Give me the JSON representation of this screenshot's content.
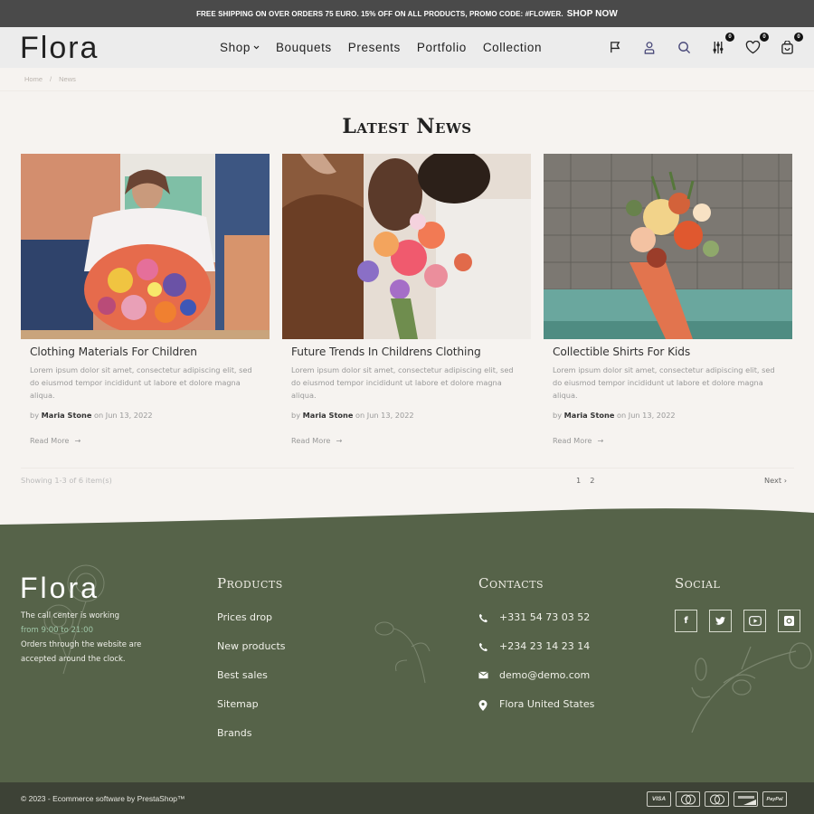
{
  "topbar": {
    "message": "FREE SHIPPING ON OVER ORDERS 75 EURO. 15% OFF ON ALL PRODUCTS, PROMO CODE: #FLOWER.",
    "cta": "SHOP NOW"
  },
  "header": {
    "logo": "Flora",
    "nav": [
      {
        "label": "Shop",
        "has_dropdown": true
      },
      {
        "label": "Bouquets"
      },
      {
        "label": "Presents"
      },
      {
        "label": "Portfolio"
      },
      {
        "label": "Collection"
      }
    ],
    "icons": [
      {
        "name": "flag-icon"
      },
      {
        "name": "user-icon"
      },
      {
        "name": "search-icon"
      },
      {
        "name": "compare-icon",
        "count": "0"
      },
      {
        "name": "heart-icon",
        "count": "0"
      },
      {
        "name": "cart-icon",
        "count": "0"
      }
    ],
    "accent_color": "#4a4a7a"
  },
  "breadcrumb": [
    {
      "label": "Home"
    },
    {
      "label": "News"
    }
  ],
  "main": {
    "title": "Latest News",
    "posts": [
      {
        "title": "Clothing Materials For Children",
        "excerpt": "Lorem ipsum dolor sit amet, consectetur adipiscing elit, sed do eiusmod tempor incididunt ut labore et dolore magna aliqua.",
        "by": "by",
        "author": "Maria Stone",
        "date": "on Jun 13, 2022",
        "read_more": "Read More"
      },
      {
        "title": "Future Trends In Childrens Clothing",
        "excerpt": "Lorem ipsum dolor sit amet, consectetur adipiscing elit, sed do eiusmod tempor incididunt ut labore et dolore magna aliqua.",
        "by": "by",
        "author": "Maria Stone",
        "date": "on Jun 13, 2022",
        "read_more": "Read More"
      },
      {
        "title": "Collectible Shirts For Kids",
        "excerpt": "Lorem ipsum dolor sit amet, consectetur adipiscing elit, sed do eiusmod tempor incididunt ut labore et dolore magna aliqua.",
        "by": "by",
        "author": "Maria Stone",
        "date": "on Jun 13, 2022",
        "read_more": "Read More"
      }
    ],
    "pagination": {
      "summary": "Showing 1-3 of 6 item(s)",
      "pages": [
        "1",
        "2"
      ],
      "current": "1",
      "next": "Next"
    }
  },
  "footer": {
    "logo": "Flora",
    "about_line1": "The call center is working",
    "about_hours": "from 9:00 to 21:00",
    "about_line2": "Orders through the website are accepted around the clock.",
    "products_title": "Products",
    "products": [
      "Prices drop",
      "New products",
      "Best sales",
      "Sitemap",
      "Brands"
    ],
    "contacts_title": "Contacts",
    "contacts": [
      {
        "icon": "phone-icon",
        "text": "+331 54 73 03 52"
      },
      {
        "icon": "phone-icon",
        "text": "+234 23 14 23 14"
      },
      {
        "icon": "mail-icon",
        "text": "demo@demo.com"
      },
      {
        "icon": "location-icon",
        "text": "Flora United States"
      }
    ],
    "social_title": "Social",
    "socials": [
      "facebook",
      "twitter",
      "youtube",
      "instagram"
    ],
    "copyright": "© 2023 - Ecommerce software by PrestaShop™",
    "payments": [
      "VISA",
      "Mastercard",
      "Maestro",
      "Discover",
      "PayPal"
    ],
    "bg_color": "#566349"
  }
}
